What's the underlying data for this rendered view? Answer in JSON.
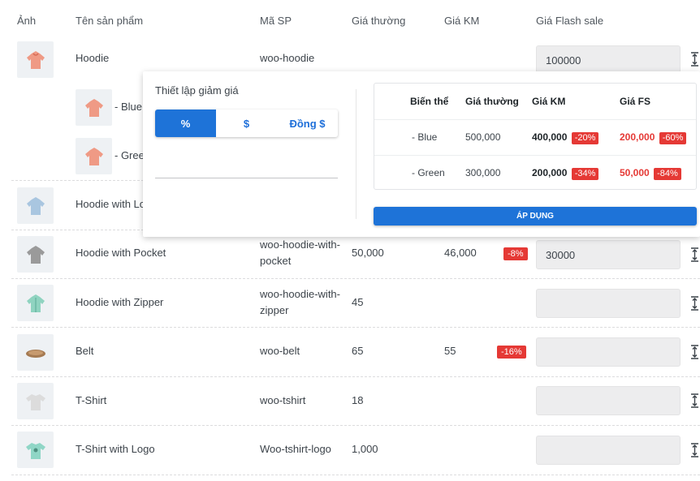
{
  "headers": {
    "image": "Ảnh",
    "name": "Tên sản phẩm",
    "sku": "Mã SP",
    "regular": "Giá thường",
    "sale": "Giá KM",
    "flash": "Giá Flash sale"
  },
  "products": [
    {
      "name": "Hoodie",
      "sku": "woo-hoodie",
      "regular": "",
      "sale": "",
      "sale_badge": "",
      "flash": "100000"
    },
    {
      "name": "Hoodie with Lo",
      "sku": "",
      "regular": "",
      "sale": "",
      "sale_badge": "",
      "flash": ""
    },
    {
      "name": "Hoodie with Pocket",
      "sku_line1": "woo-hoodie-with-",
      "sku_line2": "pocket",
      "regular": "50,000",
      "sale": "46,000",
      "sale_badge": "-8%",
      "flash": "30000"
    },
    {
      "name": "Hoodie with Zipper",
      "sku_line1": "woo-hoodie-with-",
      "sku_line2": "zipper",
      "regular": "45",
      "sale": "",
      "sale_badge": "",
      "flash": ""
    },
    {
      "name": "Belt",
      "sku": "woo-belt",
      "regular": "65",
      "sale": "55",
      "sale_badge": "-16%",
      "flash": ""
    },
    {
      "name": "T-Shirt",
      "sku": "woo-tshirt",
      "regular": "18",
      "sale": "",
      "sale_badge": "",
      "flash": ""
    },
    {
      "name": "T-Shirt with Logo",
      "sku": "Woo-tshirt-logo",
      "regular": "1,000",
      "sale": "",
      "sale_badge": "",
      "flash": ""
    }
  ],
  "variations": [
    {
      "label": "- Blue"
    },
    {
      "label": "- Green"
    }
  ],
  "popup": {
    "title": "Thiết lập giảm giá",
    "modes": [
      "%",
      "$",
      "Đồng $"
    ],
    "active_mode": "%",
    "input_value": "",
    "table_headers": {
      "variant": "Biến thể",
      "regular": "Giá thường",
      "sale": "Giá KM",
      "fs": "Giá FS"
    },
    "rows": [
      {
        "variant": "- Blue",
        "regular": "500,000",
        "sale": "400,000",
        "sale_badge": "-20%",
        "fs": "200,000",
        "fs_badge": "-60%"
      },
      {
        "variant": "- Green",
        "regular": "300,000",
        "sale": "200,000",
        "sale_badge": "-34%",
        "fs": "50,000",
        "fs_badge": "-84%"
      }
    ],
    "apply_label": "ÁP DỤNG"
  },
  "colors": {
    "accent": "#1e73d8",
    "badge": "#e53935"
  },
  "icons": {
    "sort": "sort-vertical-icon",
    "product": "product-thumbnail"
  }
}
